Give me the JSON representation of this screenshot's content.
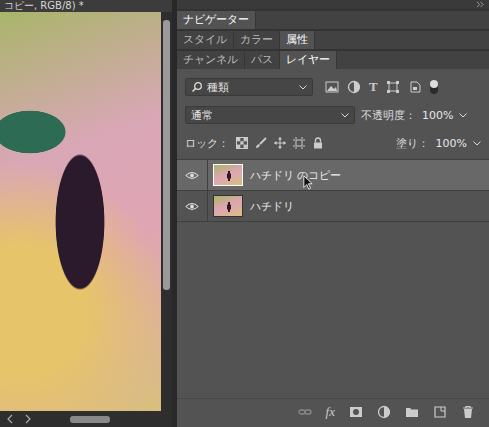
{
  "document_tab": {
    "title": "コピー, RGB/8) *"
  },
  "panel_groups": [
    {
      "tabs": [
        {
          "label": "ナビゲーター",
          "selected": true
        }
      ]
    },
    {
      "tabs": [
        {
          "label": "スタイル",
          "selected": false
        },
        {
          "label": "カラー",
          "selected": false
        },
        {
          "label": "属性",
          "selected": true
        }
      ]
    },
    {
      "tabs": [
        {
          "label": "チャンネル",
          "selected": false
        },
        {
          "label": "パス",
          "selected": false
        },
        {
          "label": "レイヤー",
          "selected": true
        }
      ]
    }
  ],
  "layers_panel": {
    "filter": {
      "label": "種類",
      "type_glyph": "T",
      "toggle_on": true
    },
    "blend_mode": "通常",
    "opacity": {
      "label": "不透明度：",
      "value": "100%"
    },
    "lock": {
      "label": "ロック："
    },
    "fill": {
      "label": "塗り：",
      "value": "100%"
    },
    "layers": [
      {
        "name": "ハチドリ のコピー",
        "visible": true,
        "selected": true
      },
      {
        "name": "ハチドリ",
        "visible": true,
        "selected": false
      }
    ]
  },
  "bottom_toolbar": {
    "effects_label": "fx"
  }
}
